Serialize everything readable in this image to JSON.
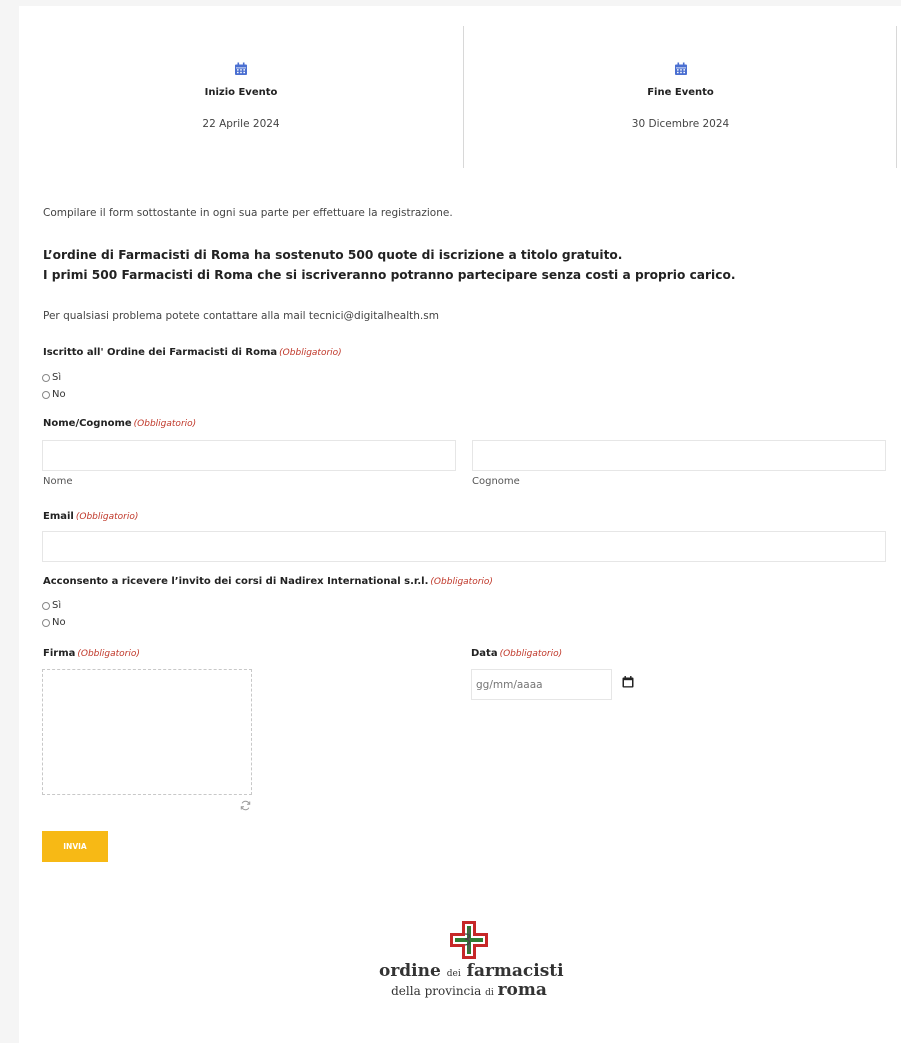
{
  "event": {
    "start": {
      "icon": "calendar-icon",
      "label": "Inizio Evento",
      "date": "22 Aprile 2024"
    },
    "end": {
      "icon": "calendar-icon",
      "label": "Fine Evento",
      "date": "30 Dicembre 2024"
    }
  },
  "intro": {
    "instructions": "Compilare il form sottostante in ogni sua parte per effettuare la registrazione.",
    "highlight_line1": "L’ordine di Farmacisti di Roma ha sostenuto 500 quote di iscrizione  a titolo gratuito.",
    "highlight_line2": "I primi 500 Farmacisti di Roma che si iscriveranno potranno partecipare senza costi a proprio carico.",
    "contact": "Per qualsiasi problema potete contattare alla mail tecnici@digitalhealth.sm"
  },
  "form": {
    "required_tag": "(Obbligatorio)",
    "iscritto": {
      "label": "Iscritto all' Ordine dei Farmacisti di Roma",
      "options": [
        "Sì",
        "No"
      ]
    },
    "nome_cognome": {
      "label": "Nome/Cognome",
      "first_sub": "Nome",
      "last_sub": "Cognome",
      "first_value": "",
      "last_value": ""
    },
    "email": {
      "label": "Email",
      "value": ""
    },
    "consenso": {
      "label": "Acconsento a ricevere l’invito dei corsi di Nadirex International s.r.l.",
      "options": [
        "Sì",
        "No"
      ]
    },
    "firma": {
      "label": "Firma",
      "icon": "refresh-icon"
    },
    "data": {
      "label": "Data",
      "placeholder": "gg/mm/aaaa",
      "icon": "calendar-icon"
    },
    "submit_label": "INVIA"
  },
  "logo": {
    "line1_a": "ordine",
    "line1_b": "dei",
    "line1_c": "farmacisti",
    "line2_a": "della",
    "line2_b": "provincia",
    "line2_c": "di",
    "line2_d": "roma"
  },
  "colors": {
    "accent": "#f7b915",
    "required": "#c0392b",
    "calendar": "#4a6fd1"
  }
}
